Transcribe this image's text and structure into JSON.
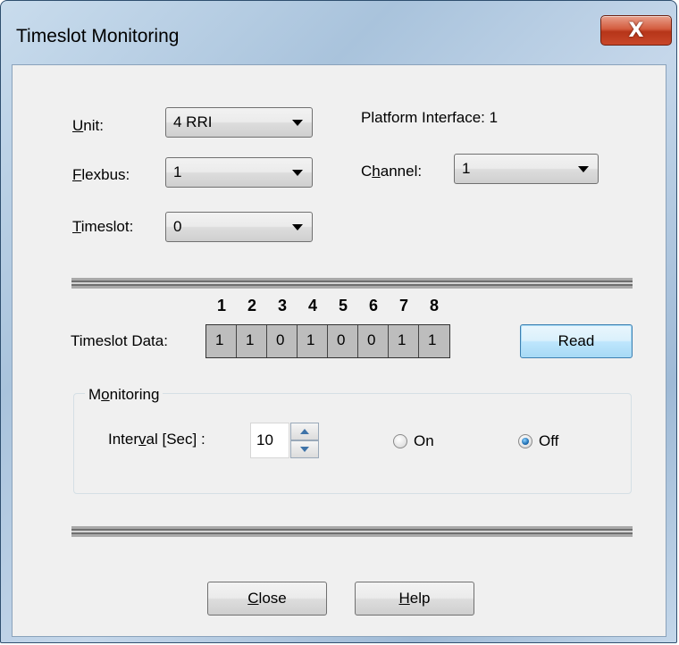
{
  "window": {
    "title": "Timeslot Monitoring",
    "close_glyph": "X"
  },
  "fields": {
    "unit": {
      "label_pre": "",
      "label_acc": "U",
      "label_post": "nit:",
      "value": "4 RRI"
    },
    "flexbus": {
      "label_pre": "",
      "label_acc": "F",
      "label_post": "lexbus:",
      "value": "1"
    },
    "timeslot": {
      "label_pre": "",
      "label_acc": "T",
      "label_post": "imeslot:",
      "value": "0"
    },
    "channel": {
      "label_pre": "C",
      "label_acc": "h",
      "label_post": "annel:",
      "value": "1"
    },
    "platform_interface": "Platform Interface: 1"
  },
  "timeslot_data": {
    "label": "Timeslot Data:",
    "bit_numbers": [
      "1",
      "2",
      "3",
      "4",
      "5",
      "6",
      "7",
      "8"
    ],
    "bits": [
      "1",
      "1",
      "0",
      "1",
      "0",
      "0",
      "1",
      "1"
    ]
  },
  "read_button": "Read",
  "monitoring": {
    "title_pre": "M",
    "title_acc": "o",
    "title_post": "nitoring",
    "interval_pre": "Inter",
    "interval_acc": "v",
    "interval_post": "al [Sec] :",
    "interval_value": "10",
    "on_label": "On",
    "off_label": "Off",
    "selected": "Off"
  },
  "buttons": {
    "close": {
      "acc": "C",
      "post": "lose"
    },
    "help": {
      "acc": "H",
      "post": "elp"
    }
  }
}
